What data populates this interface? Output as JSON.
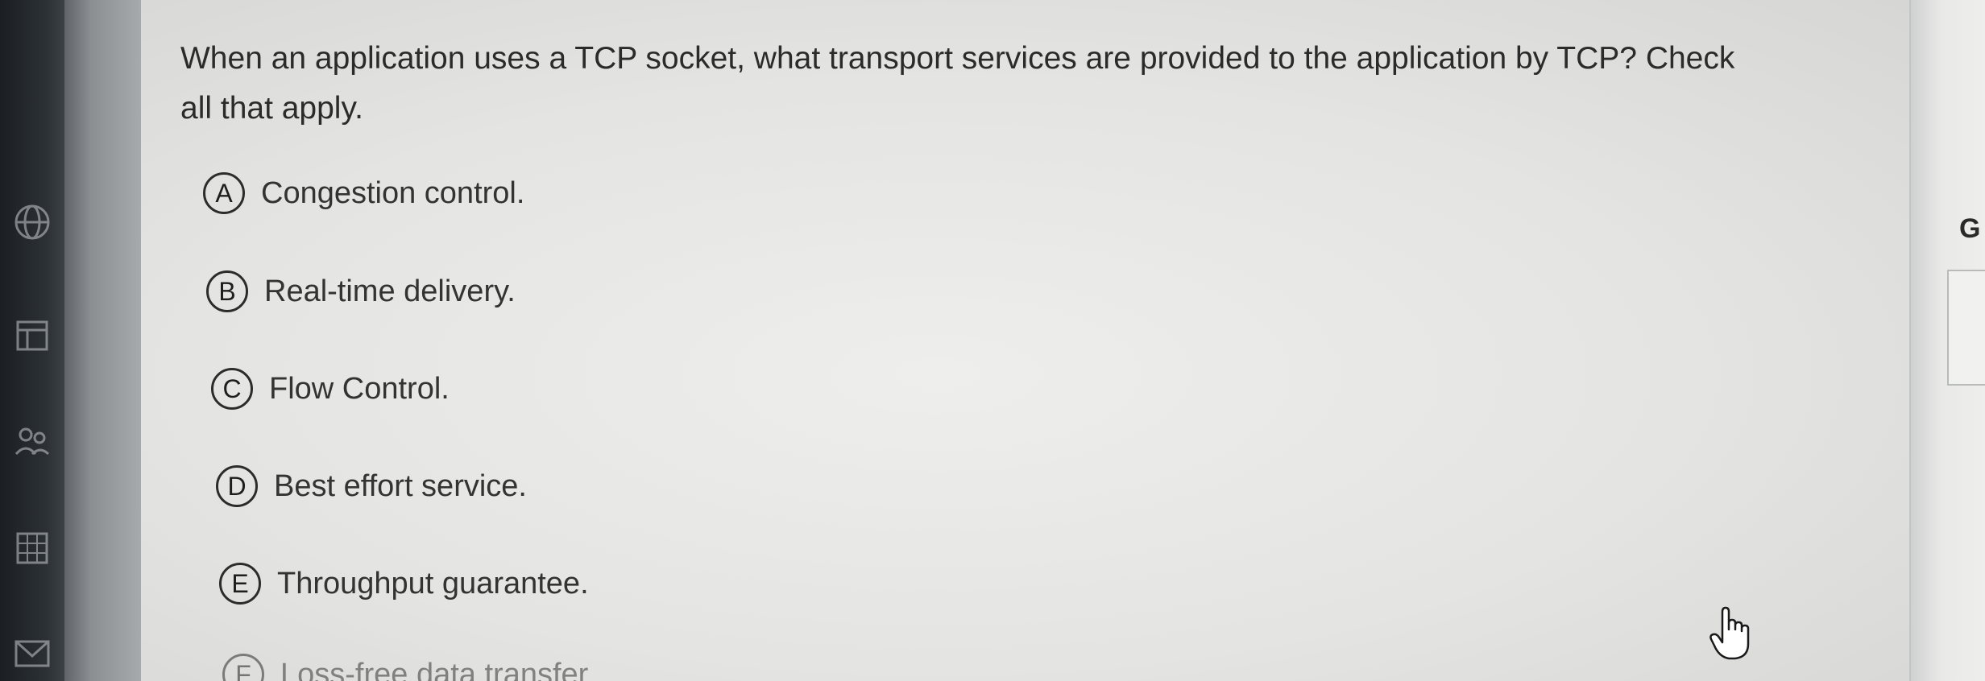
{
  "question": {
    "line1": "When an application uses a TCP socket, what transport services are provided to the application by TCP? Check",
    "line2": "all that apply."
  },
  "options": [
    {
      "letter": "A",
      "text": "Congestion control."
    },
    {
      "letter": "B",
      "text": "Real-time delivery."
    },
    {
      "letter": "C",
      "text": "Flow Control."
    },
    {
      "letter": "D",
      "text": "Best effort service."
    },
    {
      "letter": "E",
      "text": "Throughput guarantee."
    },
    {
      "letter": "F",
      "text": "Loss-free data transfer"
    }
  ],
  "right_panel": {
    "fragment_g": "G"
  },
  "icons": {
    "sidebar": [
      "globe-icon",
      "calendar-icon",
      "people-icon",
      "grid-icon",
      "mail-icon"
    ],
    "cursor": "hand-pointer-icon"
  },
  "colors": {
    "text": "#2b2b2b",
    "panel": "#e8e8e6",
    "sidebar": "#1f2327"
  }
}
